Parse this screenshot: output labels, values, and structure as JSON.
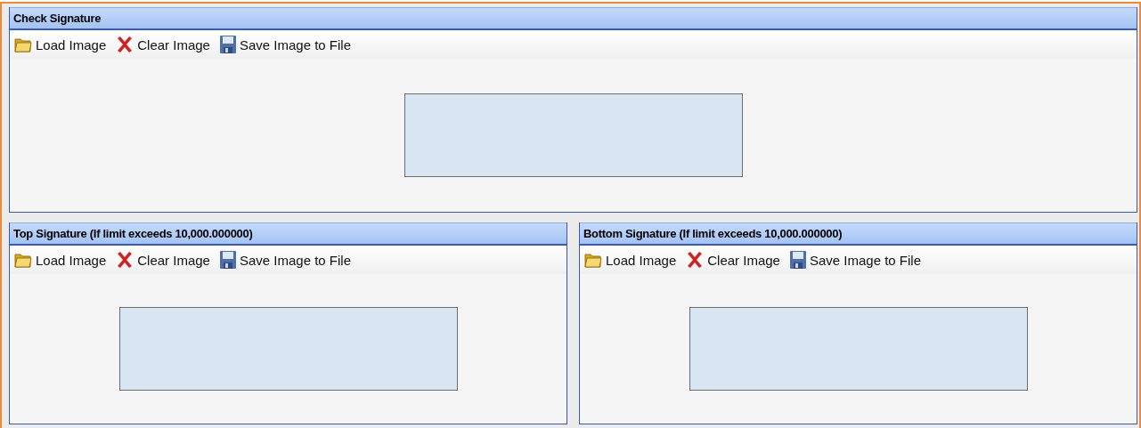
{
  "panels": [
    {
      "title": "Check Signature",
      "toolbar": [
        {
          "kind": "load",
          "label": "Load Image"
        },
        {
          "kind": "clear",
          "label": "Clear Image"
        },
        {
          "kind": "save",
          "label": "Save Image to File"
        }
      ]
    },
    {
      "title": "Top Signature (If limit exceeds 10,000.000000)",
      "toolbar": [
        {
          "kind": "load",
          "label": "Load Image"
        },
        {
          "kind": "clear",
          "label": "Clear Image"
        },
        {
          "kind": "save",
          "label": "Save Image to File"
        }
      ]
    },
    {
      "title": "Bottom Signature (If limit exceeds 10,000.000000)",
      "toolbar": [
        {
          "kind": "load",
          "label": "Load Image"
        },
        {
          "kind": "clear",
          "label": "Clear Image"
        },
        {
          "kind": "save",
          "label": "Save Image to File"
        }
      ]
    }
  ]
}
